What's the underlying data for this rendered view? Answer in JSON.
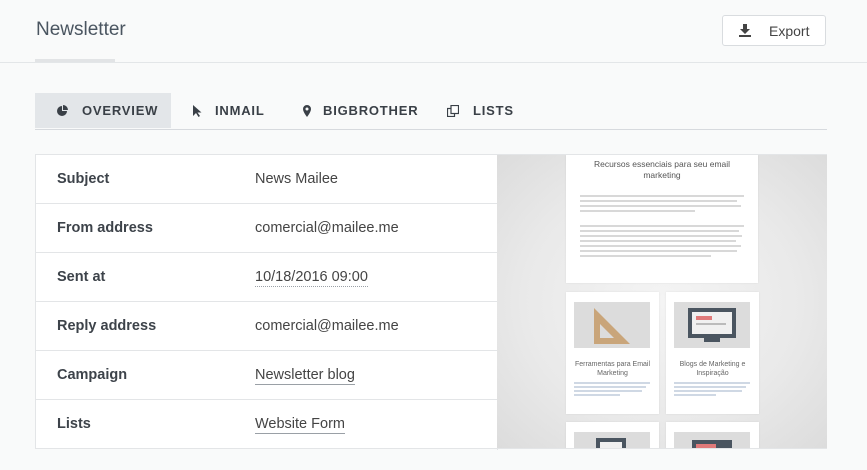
{
  "header": {
    "title": "Newsletter",
    "export_label": "Export"
  },
  "tabs": [
    {
      "label": "Overview",
      "icon": "pie-chart-icon",
      "active": true
    },
    {
      "label": "Inmail",
      "icon": "cursor-icon",
      "active": false
    },
    {
      "label": "Bigbrother",
      "icon": "map-pin-icon",
      "active": false
    },
    {
      "label": "Lists",
      "icon": "copy-icon",
      "active": false
    }
  ],
  "details": [
    {
      "label": "Subject",
      "value": "News Mailee",
      "link": false
    },
    {
      "label": "From address",
      "value": "comercial@mailee.me",
      "link": false
    },
    {
      "label": "Sent at",
      "value": "10/18/2016 09:00",
      "link": false
    },
    {
      "label": "Reply address",
      "value": "comercial@mailee.me",
      "link": false
    },
    {
      "label": "Campaign",
      "value": "Newsletter blog",
      "link": true
    },
    {
      "label": "Lists",
      "value": "Website Form",
      "link": true
    }
  ],
  "preview": {
    "headline": "Recursos essenciais para seu email marketing",
    "card1_caption": "Ferramentas para Email Marketing",
    "card2_caption": "Blogs de Marketing e Inspiração"
  },
  "colors": {
    "active_tab_bg": "#e3e6e9",
    "border": "#e3e5e7"
  }
}
